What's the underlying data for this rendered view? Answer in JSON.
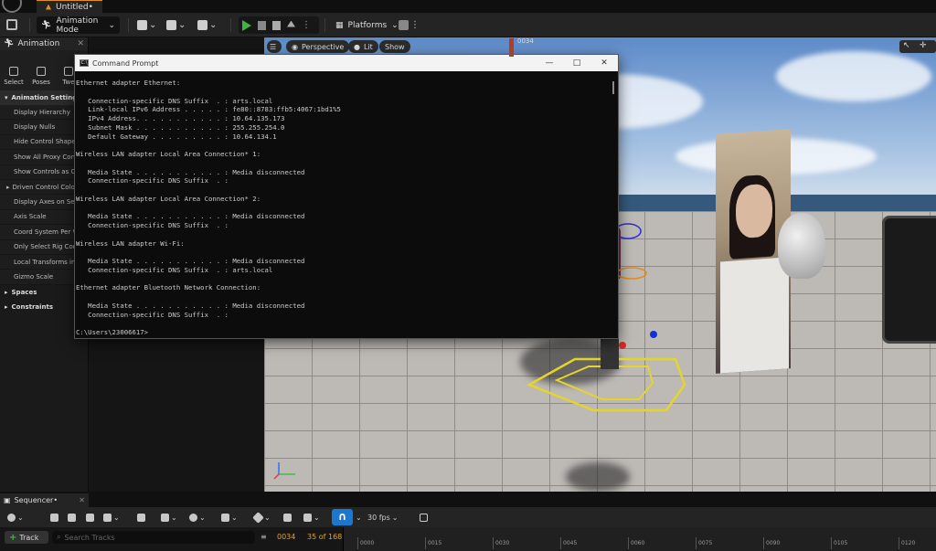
{
  "app": {
    "document_tab": "Untitled•",
    "toolbar": {
      "mode": "Animation Mode",
      "platforms": "Platforms"
    }
  },
  "left_panel": {
    "tab": "Animation",
    "tools": [
      "Select",
      "Poses",
      "Twe"
    ],
    "sections": [
      {
        "label": "Animation Settings",
        "expanded": true
      },
      {
        "label": "Spaces",
        "expanded": false
      },
      {
        "label": "Constraints",
        "expanded": false
      }
    ],
    "items": [
      "Display Hierarchy",
      "Display Nulls",
      "Hide Control Shapes",
      "Show All Proxy Contro",
      "Show Controls as Ove",
      "Driven Control Color",
      "Display Axes on Selec",
      "Axis Scale",
      "Coord System Per Wid",
      "Only Select Rig Contr",
      "Local Transforms in E",
      "Gizmo Scale"
    ]
  },
  "viewport": {
    "perspective": "Perspective",
    "lit": "Lit",
    "show": "Show"
  },
  "command_prompt": {
    "title": "Command Prompt",
    "lines": [
      "Ethernet adapter Ethernet:",
      "",
      "   Connection-specific DNS Suffix  . : arts.local",
      "   Link-local IPv6 Address . . . . . : fe80::8783:ffb5:4067:1bd1%5",
      "   IPv4 Address. . . . . . . . . . . : 10.64.135.173",
      "   Subnet Mask . . . . . . . . . . . : 255.255.254.0",
      "   Default Gateway . . . . . . . . . : 10.64.134.1",
      "",
      "Wireless LAN adapter Local Area Connection* 1:",
      "",
      "   Media State . . . . . . . . . . . : Media disconnected",
      "   Connection-specific DNS Suffix  . :",
      "",
      "Wireless LAN adapter Local Area Connection* 2:",
      "",
      "   Media State . . . . . . . . . . . : Media disconnected",
      "   Connection-specific DNS Suffix  . :",
      "",
      "Wireless LAN adapter Wi-Fi:",
      "",
      "   Media State . . . . . . . . . . . : Media disconnected",
      "   Connection-specific DNS Suffix  . : arts.local",
      "",
      "Ethernet adapter Bluetooth Network Connection:",
      "",
      "   Media State . . . . . . . . . . . : Media disconnected",
      "   Connection-specific DNS Suffix  . :",
      "",
      "C:\\Users\\23006617>"
    ]
  },
  "sequencer": {
    "tab": "Sequencer•",
    "fps": "30 fps",
    "track_button": "Track",
    "search_placeholder": "Search Tracks",
    "current_frame": "0034",
    "frame_position": "35 of 168",
    "playhead_label": "0034",
    "ruler_ticks": [
      "0000",
      "0015",
      "0030",
      "0045",
      "0060",
      "0075",
      "0090",
      "0105",
      "0120"
    ]
  },
  "colors": {
    "accent_orange": "#e38f1b",
    "snap_blue": "#1a78d1",
    "play_green": "#3fb33f"
  }
}
